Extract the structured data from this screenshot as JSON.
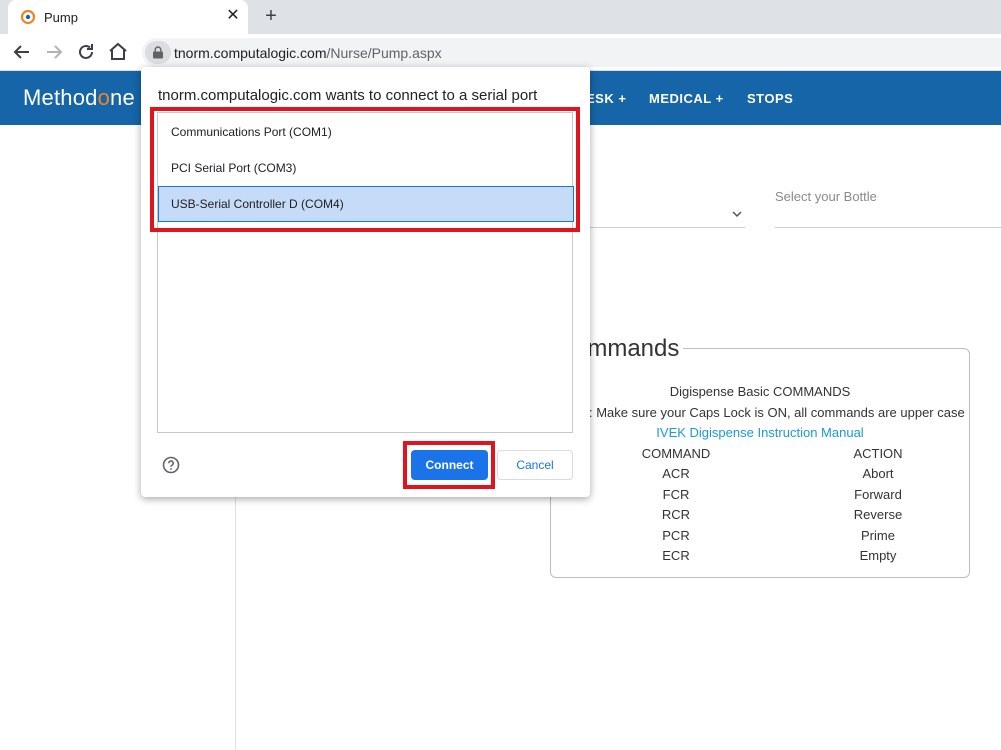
{
  "browser": {
    "tab_title": "Pump",
    "tab_close": "✕",
    "new_tab": "+",
    "url_host": "tnorm.computalogic.com",
    "url_path": "/Nurse/Pump.aspx"
  },
  "site": {
    "logo_pre": "Method",
    "logo_o": "o",
    "logo_post": "ne",
    "menu": [
      {
        "label": "ESK +"
      },
      {
        "label": "MEDICAL +"
      },
      {
        "label": "STOPS"
      }
    ],
    "bottle_label": "Select your Bottle"
  },
  "commands": {
    "legend": "ommands",
    "title": "Digispense Basic COMMANDS",
    "note": ": Make sure your Caps Lock is ON, all commands are upper case",
    "manual_link": "IVEK Digispense Instruction Manual",
    "header_command": "COMMAND",
    "header_action": "ACTION",
    "rows": [
      {
        "command": "ACR",
        "action": "Abort"
      },
      {
        "command": "FCR",
        "action": "Forward"
      },
      {
        "command": "RCR",
        "action": "Reverse"
      },
      {
        "command": "PCR",
        "action": "Prime"
      },
      {
        "command": "ECR",
        "action": "Empty"
      }
    ]
  },
  "dialog": {
    "title": "tnorm.computalogic.com wants to connect to a serial port",
    "ports": [
      {
        "label": "Communications Port (COM1)",
        "selected": false
      },
      {
        "label": "PCI Serial Port (COM3)",
        "selected": false
      },
      {
        "label": "USB-Serial Controller D (COM4)",
        "selected": true
      }
    ],
    "connect_label": "Connect",
    "cancel_label": "Cancel"
  },
  "colors": {
    "header_bg": "#1565a8",
    "accent": "#1a73e8",
    "highlight": "#e0141f",
    "link": "#1a9ad6"
  }
}
